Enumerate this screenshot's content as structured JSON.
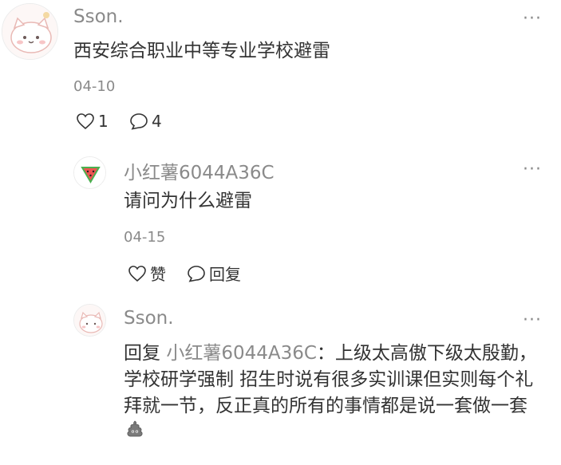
{
  "comments": [
    {
      "username": "Sson.",
      "text": "西安综合职业中等专业学校避雷",
      "date": "04-10",
      "likes": "1",
      "replies": "4",
      "more": "···"
    },
    {
      "username": "小红薯6044A36C",
      "text": "请问为什么避雷",
      "date": "04-15",
      "like_label": "赞",
      "reply_label": "回复",
      "more": "···"
    },
    {
      "username": "Sson.",
      "reply_prefix": "回复",
      "mention": "小红薯6044A36C",
      "separator": "：",
      "text": "上级太高傲下级太殷勤，学校研学强制 招生时说有很多实训课但实则每个礼拜就一节，反正真的所有的事情都是说一套做一套",
      "emoji": "poop-emoji",
      "more": "···"
    }
  ],
  "icons": [
    "heart-icon",
    "comment-icon",
    "more-icon"
  ],
  "colors": {
    "text": "#333333",
    "secondary": "#8a8a8a"
  }
}
